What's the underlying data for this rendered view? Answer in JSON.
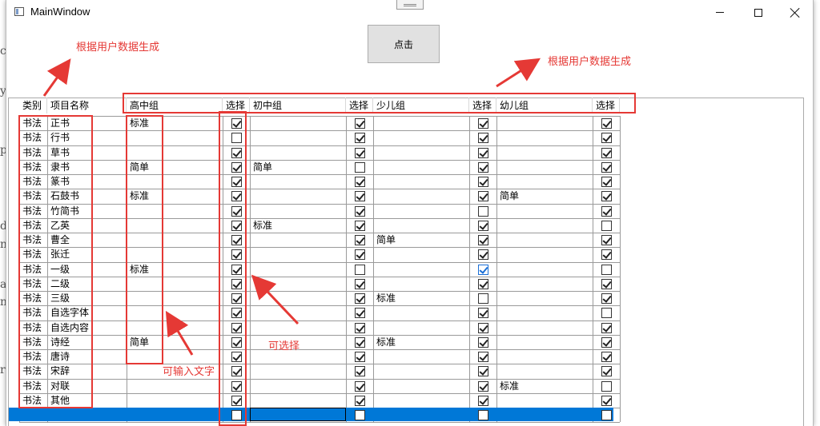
{
  "window": {
    "title": "MainWindow"
  },
  "toolbar": {
    "click_label": "点击"
  },
  "background_chars": [
    "c",
    "y",
    "p",
    "d",
    "n",
    "a",
    "n",
    "r"
  ],
  "columns": [
    "类别",
    "项目名称",
    "高中组",
    "选择",
    "初中组",
    "选择",
    "少儿组",
    "选择",
    "幼儿组",
    "选择"
  ],
  "rows": [
    {
      "cat": "书法",
      "name": "正书",
      "g1": "标准",
      "c1": true,
      "g2": "",
      "c2": true,
      "g3": "",
      "c3": true,
      "g4": "",
      "c4": true
    },
    {
      "cat": "书法",
      "name": "行书",
      "g1": "",
      "c1": false,
      "g2": "",
      "c2": true,
      "g3": "",
      "c3": true,
      "g4": "",
      "c4": true
    },
    {
      "cat": "书法",
      "name": "草书",
      "g1": "",
      "c1": true,
      "g2": "",
      "c2": true,
      "g3": "",
      "c3": true,
      "g4": "",
      "c4": true
    },
    {
      "cat": "书法",
      "name": "隶书",
      "g1": "简单",
      "c1": true,
      "g2": "简单",
      "c2": false,
      "g3": "",
      "c3": true,
      "g4": "",
      "c4": true
    },
    {
      "cat": "书法",
      "name": "篆书",
      "g1": "",
      "c1": true,
      "g2": "",
      "c2": true,
      "g3": "",
      "c3": true,
      "g4": "",
      "c4": true
    },
    {
      "cat": "书法",
      "name": "石鼓书",
      "g1": "标准",
      "c1": true,
      "g2": "",
      "c2": true,
      "g3": "",
      "c3": true,
      "g4": "简单",
      "c4": true
    },
    {
      "cat": "书法",
      "name": "竹简书",
      "g1": "",
      "c1": true,
      "g2": "",
      "c2": true,
      "g3": "",
      "c3": false,
      "g4": "",
      "c4": true
    },
    {
      "cat": "书法",
      "name": "乙英",
      "g1": "",
      "c1": true,
      "g2": "标准",
      "c2": true,
      "g3": "",
      "c3": true,
      "g4": "",
      "c4": false
    },
    {
      "cat": "书法",
      "name": "曹全",
      "g1": "",
      "c1": true,
      "g2": "",
      "c2": true,
      "g3": "简单",
      "c3": true,
      "g4": "",
      "c4": true
    },
    {
      "cat": "书法",
      "name": "张迁",
      "g1": "",
      "c1": true,
      "g2": "",
      "c2": true,
      "g3": "",
      "c3": true,
      "g4": "",
      "c4": true
    },
    {
      "cat": "书法",
      "name": "一级",
      "g1": "标准",
      "c1": true,
      "g2": "",
      "c2": false,
      "g3": "",
      "c3": true,
      "g4": "",
      "c4": false
    },
    {
      "cat": "书法",
      "name": "二级",
      "g1": "",
      "c1": true,
      "g2": "",
      "c2": true,
      "g3": "",
      "c3": true,
      "g4": "",
      "c4": true
    },
    {
      "cat": "书法",
      "name": "三级",
      "g1": "",
      "c1": true,
      "g2": "",
      "c2": true,
      "g3": "标准",
      "c3": false,
      "g4": "",
      "c4": true
    },
    {
      "cat": "书法",
      "name": "自选字体",
      "g1": "",
      "c1": true,
      "g2": "",
      "c2": true,
      "g3": "",
      "c3": true,
      "g4": "",
      "c4": false
    },
    {
      "cat": "书法",
      "name": "自选内容",
      "g1": "",
      "c1": true,
      "g2": "",
      "c2": true,
      "g3": "",
      "c3": true,
      "g4": "",
      "c4": true
    },
    {
      "cat": "书法",
      "name": "诗经",
      "g1": "简单",
      "c1": true,
      "g2": "",
      "c2": true,
      "g3": "标准",
      "c3": true,
      "g4": "",
      "c4": true
    },
    {
      "cat": "书法",
      "name": "唐诗",
      "g1": "",
      "c1": true,
      "g2": "",
      "c2": true,
      "g3": "",
      "c3": true,
      "g4": "",
      "c4": true
    },
    {
      "cat": "书法",
      "name": "宋辞",
      "g1": "",
      "c1": true,
      "g2": "",
      "c2": true,
      "g3": "",
      "c3": true,
      "g4": "",
      "c4": true
    },
    {
      "cat": "书法",
      "name": "对联",
      "g1": "",
      "c1": true,
      "g2": "",
      "c2": true,
      "g3": "",
      "c3": true,
      "g4": "标准",
      "c4": false
    },
    {
      "cat": "书法",
      "name": "其他",
      "g1": "",
      "c1": true,
      "g2": "",
      "c2": true,
      "g3": "",
      "c3": true,
      "g4": "",
      "c4": true
    }
  ],
  "annotations": {
    "note_user_data_left": "根据用户数据生成",
    "note_user_data_right": "根据用户数据生成",
    "note_selectable": "可选择",
    "note_text_input": "可输入文字",
    "color": "#e53935"
  },
  "colors": {
    "selection_row": "#0078d7",
    "check_highlight": "#1a6fd6"
  }
}
